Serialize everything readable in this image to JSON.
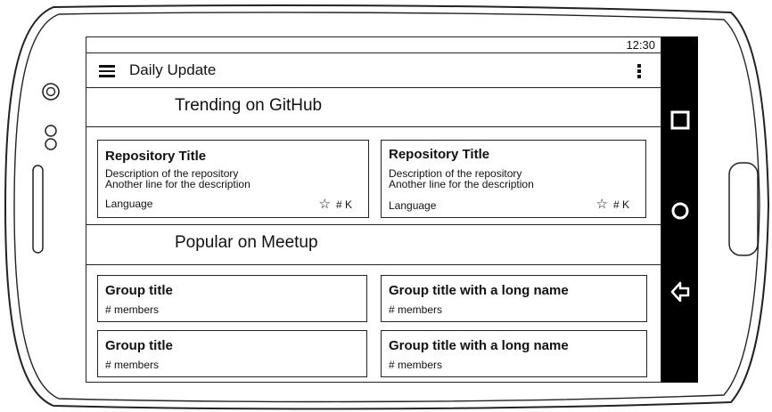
{
  "status_bar": {
    "time": "12:30"
  },
  "app_bar": {
    "title": "Daily Update"
  },
  "trending": {
    "title": "Trending on GitHub",
    "repos": [
      {
        "title": "Repository Title",
        "desc1": "Description of the repository",
        "desc2": "Another line for the description",
        "language": "Language",
        "stars": "# K"
      },
      {
        "title": "Repository Title",
        "desc1": "Description of the repository",
        "desc2": "Another line for the description",
        "language": "Language",
        "stars": "# K"
      }
    ]
  },
  "meetup": {
    "title": "Popular on Meetup",
    "groups": [
      {
        "title": "Group title",
        "members": "# members"
      },
      {
        "title": "Group title with a long name",
        "members": "# members"
      },
      {
        "title": "Group title",
        "members": "# members"
      },
      {
        "title": "Group title with a long name",
        "members": "# members"
      }
    ]
  },
  "icons": {
    "menu": "hamburger-menu-icon",
    "overflow": "more-vert-icon",
    "star": "star-outline-icon",
    "nav_recents": "square-icon",
    "nav_home": "circle-icon",
    "nav_back": "back-arrow-icon"
  }
}
